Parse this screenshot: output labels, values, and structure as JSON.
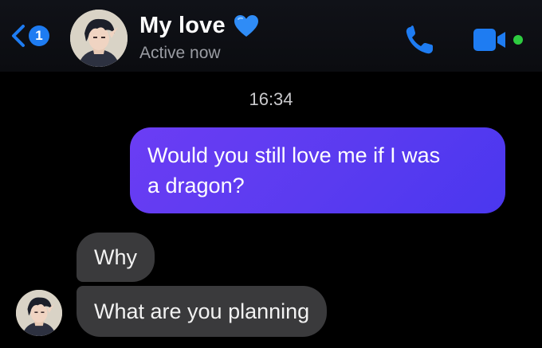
{
  "header": {
    "unread_count": "1",
    "contact_name": "My love",
    "status": "Active now",
    "icons": {
      "back": "chevron-left-icon",
      "heart": "blue-heart-emoji",
      "call": "phone-icon",
      "video": "video-camera-icon",
      "online": "online-dot"
    },
    "colors": {
      "accent": "#1e7cf2",
      "heart": "#2f8cf6",
      "online": "#2ecc40"
    }
  },
  "conversation": {
    "timestamp": "16:34",
    "messages": [
      {
        "sender": "me",
        "line1": "Would you still love me if I was",
        "line2": "a dragon?"
      },
      {
        "sender": "them",
        "text": "Why"
      },
      {
        "sender": "them",
        "text": "What are you planning"
      }
    ],
    "colors": {
      "outgoing_bubble": "#5a3bf0",
      "incoming_bubble": "#3a3a3c"
    }
  }
}
